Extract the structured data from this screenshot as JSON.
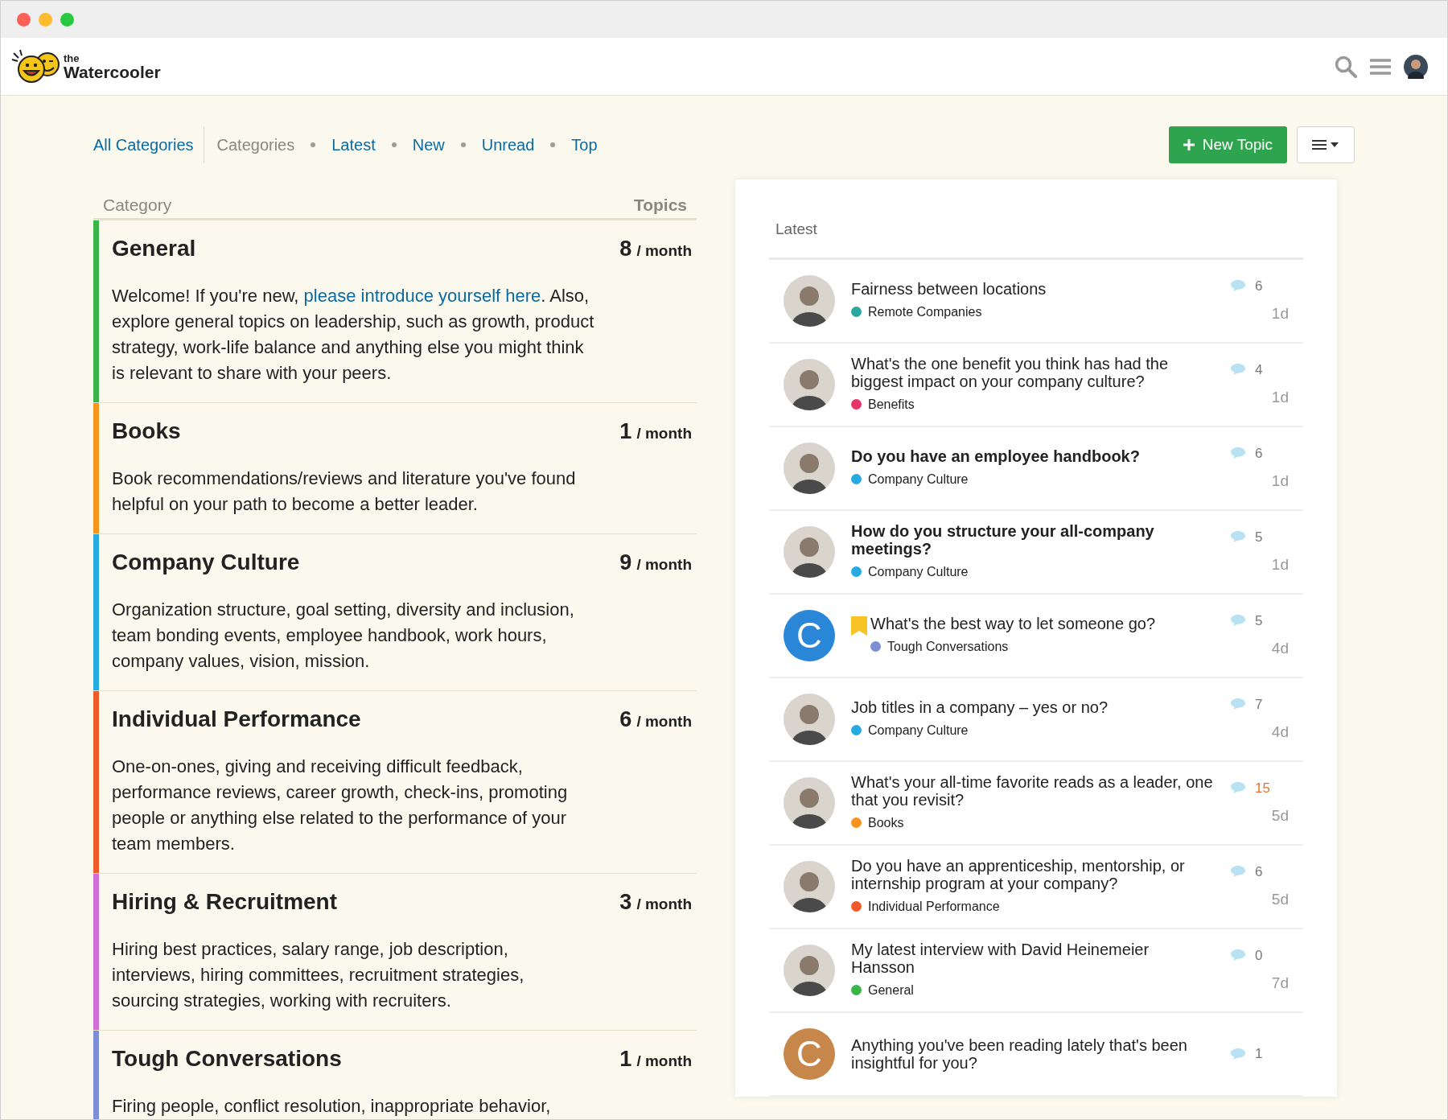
{
  "header": {
    "logo_small": "the",
    "logo_name": "Watercooler"
  },
  "nav": {
    "items": [
      {
        "label": "All Categories",
        "kind": "dropdown",
        "selected": false
      },
      {
        "label": "Categories",
        "kind": "tab",
        "selected": true
      },
      {
        "label": "Latest",
        "kind": "tab",
        "selected": false
      },
      {
        "label": "New",
        "kind": "tab",
        "selected": false
      },
      {
        "label": "Unread",
        "kind": "tab",
        "selected": false
      },
      {
        "label": "Top",
        "kind": "tab",
        "selected": false
      }
    ],
    "new_topic": "New Topic"
  },
  "categories": {
    "column_1": "Category",
    "column_2": "Topics",
    "rows": [
      {
        "name": "General",
        "color": "#3ab54a",
        "count": "8",
        "period": "/ month",
        "description": [
          {
            "kind": "text",
            "text": "Welcome! If you're new, "
          },
          {
            "kind": "link",
            "text": "please introduce yourself here"
          },
          {
            "kind": "text",
            "text": ". Also, explore general topics on leadership, such as growth, product strategy, work-life balance and anything else you might think is relevant to share with your peers."
          }
        ]
      },
      {
        "name": "Books",
        "color": "#f7941d",
        "count": "1",
        "period": "/ month",
        "description": [
          {
            "kind": "text",
            "text": "Book recommendations/reviews and literature you've found helpful on your path to become a better leader."
          }
        ]
      },
      {
        "name": "Company Culture",
        "color": "#25aae1",
        "count": "9",
        "period": "/ month",
        "description": [
          {
            "kind": "text",
            "text": "Organization structure, goal setting, diversity and inclusion, team bonding events, employee handbook, work hours, company values, vision, mission."
          }
        ]
      },
      {
        "name": "Individual Performance",
        "color": "#f05a28",
        "count": "6",
        "period": "/ month",
        "description": [
          {
            "kind": "text",
            "text": "One-on-ones, giving and receiving difficult feedback, performance reviews, career growth, check-ins, promoting people or anything else related to the performance of your team members."
          }
        ]
      },
      {
        "name": "Hiring & Recruitment",
        "color": "#d16fd6",
        "count": "3",
        "period": "/ month",
        "description": [
          {
            "kind": "text",
            "text": "Hiring best practices, salary range, job description, interviews, hiring committees, recruitment strategies, sourcing strategies, working with recruiters."
          }
        ]
      },
      {
        "name": "Tough Conversations",
        "color": "#7b8ed6",
        "count": "1",
        "period": "/ month",
        "description": [
          {
            "kind": "text",
            "text": "Firing people, conflict resolution, inappropriate behavior,"
          }
        ]
      }
    ]
  },
  "latest": {
    "title": "Latest",
    "topics": [
      {
        "title": "Fairness between locations",
        "category": "Remote Companies",
        "color": "#2aa8a0",
        "replies": "6",
        "age": "1d",
        "unread": false,
        "pinned": false,
        "hot": false,
        "avatar": {
          "kind": "figure"
        }
      },
      {
        "title": "What's the one benefit you think has had the biggest impact on your company culture?",
        "category": "Benefits",
        "color": "#e8336b",
        "replies": "4",
        "age": "1d",
        "unread": false,
        "pinned": false,
        "hot": false,
        "avatar": {
          "kind": "figure"
        }
      },
      {
        "title": "Do you have an employee handbook?",
        "category": "Company Culture",
        "color": "#25aae1",
        "replies": "6",
        "age": "1d",
        "unread": true,
        "pinned": false,
        "hot": false,
        "avatar": {
          "kind": "figure"
        }
      },
      {
        "title": "How do you structure your all-company meetings?",
        "category": "Company Culture",
        "color": "#25aae1",
        "replies": "5",
        "age": "1d",
        "unread": true,
        "pinned": false,
        "hot": false,
        "avatar": {
          "kind": "figure"
        }
      },
      {
        "title": "What's the best way to let someone go?",
        "category": "Tough Conversations",
        "color": "#7b8ed6",
        "replies": "5",
        "age": "4d",
        "unread": false,
        "pinned": true,
        "hot": false,
        "avatar": {
          "kind": "letter",
          "letter": "C",
          "color": "#2a86d6"
        }
      },
      {
        "title": "Job titles in a company – yes or no?",
        "category": "Company Culture",
        "color": "#25aae1",
        "replies": "7",
        "age": "4d",
        "unread": false,
        "pinned": false,
        "hot": false,
        "avatar": {
          "kind": "figure"
        }
      },
      {
        "title": "What's your all-time favorite reads as a leader, one that you revisit?",
        "category": "Books",
        "color": "#f7941d",
        "replies": "15",
        "age": "5d",
        "unread": false,
        "pinned": false,
        "hot": true,
        "avatar": {
          "kind": "figure"
        }
      },
      {
        "title": "Do you have an apprenticeship, mentorship, or internship program at your company?",
        "category": "Individual Performance",
        "color": "#f05a28",
        "replies": "6",
        "age": "5d",
        "unread": false,
        "pinned": false,
        "hot": false,
        "avatar": {
          "kind": "figure"
        }
      },
      {
        "title": "My latest interview with David Heinemeier Hansson",
        "category": "General",
        "color": "#3ab54a",
        "replies": "0",
        "age": "7d",
        "unread": false,
        "pinned": false,
        "hot": false,
        "avatar": {
          "kind": "figure"
        }
      },
      {
        "title": "Anything you've been reading lately that's been insightful for you?",
        "replies": "1",
        "unread": false,
        "pinned": false,
        "hot": false,
        "avatar": {
          "kind": "letter",
          "letter": "C",
          "color": "#c8874a"
        }
      }
    ]
  }
}
